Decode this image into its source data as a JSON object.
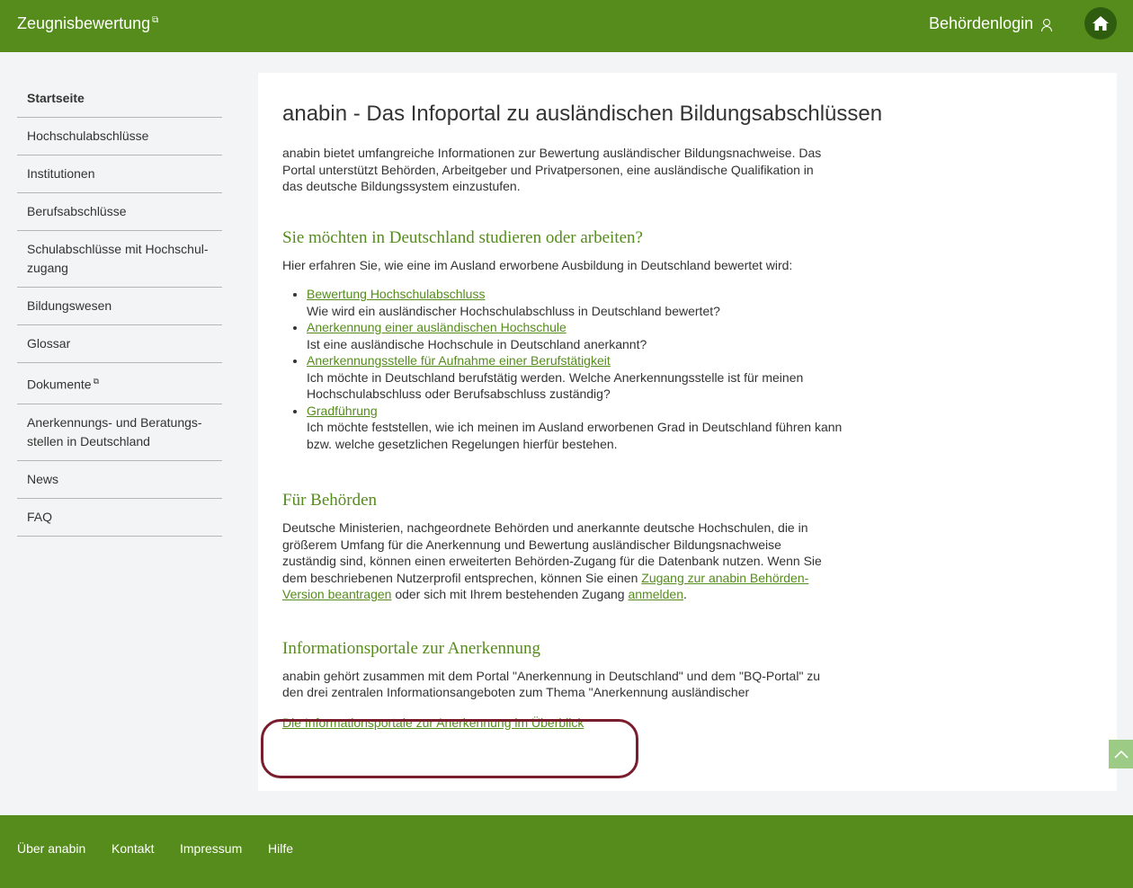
{
  "header": {
    "brand": "Zeugnisbewertung",
    "login": "Behördenlogin"
  },
  "sidebar": {
    "items": [
      {
        "label": "Startseite"
      },
      {
        "label": "Hochschulabschlüsse"
      },
      {
        "label": "Institutionen"
      },
      {
        "label": "Berufsabschlüsse"
      },
      {
        "label": "Schulabschlüsse mit Hochschul-zugang"
      },
      {
        "label": "Bildungswesen"
      },
      {
        "label": "Glossar"
      },
      {
        "label": "Dokumente"
      },
      {
        "label": "Anerkennungs- und Beratungs-stellen in Deutschland"
      },
      {
        "label": "News"
      },
      {
        "label": "FAQ"
      }
    ]
  },
  "main": {
    "title": "anabin - Das Infoportal zu ausländischen Bildungsabschlüssen",
    "intro": "anabin bietet umfangreiche Informationen zur Bewertung ausländischer Bildungsnachweise. Das Portal unterstützt Behörden, Arbeitgeber und Privatpersonen, eine ausländische Qualifikation in das deutsche Bildungssystem einzustufen.",
    "section1": {
      "heading": "Sie möchten in Deutschland studieren oder arbeiten?",
      "text": "Hier erfahren Sie, wie eine im Ausland erworbene Ausbildung in Deutschland bewertet wird:",
      "items": [
        {
          "link": "Bewertung Hochschulabschluss",
          "desc": "Wie wird ein ausländischer Hochschulabschluss in Deutschland bewertet?"
        },
        {
          "link": "Anerkennung einer ausländischen Hochschule",
          "desc": "Ist eine ausländische Hochschule in Deutschland anerkannt?"
        },
        {
          "link": "Anerkennungsstelle für Aufnahme einer Berufstätigkeit",
          "desc": "Ich möchte in Deutschland berufstätig werden. Welche Anerkennungsstelle ist für meinen Hochschulabschluss oder Berufsabschluss zuständig?"
        },
        {
          "link": "Gradführung",
          "desc": "Ich möchte feststellen, wie ich meinen im Ausland erworbenen Grad in Deutschland führen kann bzw. welche gesetzlichen Regelungen hierfür bestehen."
        }
      ]
    },
    "section2": {
      "heading": "Für Behörden",
      "text1": "Deutsche Ministerien, nachgeordnete Behörden und anerkannte deutsche Hochschulen, die in größerem Umfang für die Anerkennung und Bewertung ausländischer Bildungsnachweise zuständig sind, können einen erweiterten Behörden-Zugang für die Datenbank nutzen. Wenn Sie dem beschriebenen Nutzerprofil entsprechen, können Sie einen ",
      "link1": "Zugang zur anabin Behörden-Version beantragen",
      "text2": " oder sich mit Ihrem bestehenden Zugang ",
      "link2": "anmelden",
      "text3": "."
    },
    "section3": {
      "heading": "Informationsportale zur Anerkennung",
      "text": "anabin gehört zusammen mit dem Portal \"Anerkennung in Deutschland\" und dem \"BQ-Portal\" zu den drei zentralen Informationsangeboten zum Thema \"Anerkennung ausländischer Berufsqualifikationen\".",
      "link": "Die Informationsportale zur Anerkennung im Überblick"
    }
  },
  "footer": {
    "links": [
      "Über anabin",
      "Kontakt",
      "Impressum",
      "Hilfe"
    ]
  },
  "colors": {
    "brand_green": "#558c1b",
    "highlight": "#7a1e2e"
  }
}
